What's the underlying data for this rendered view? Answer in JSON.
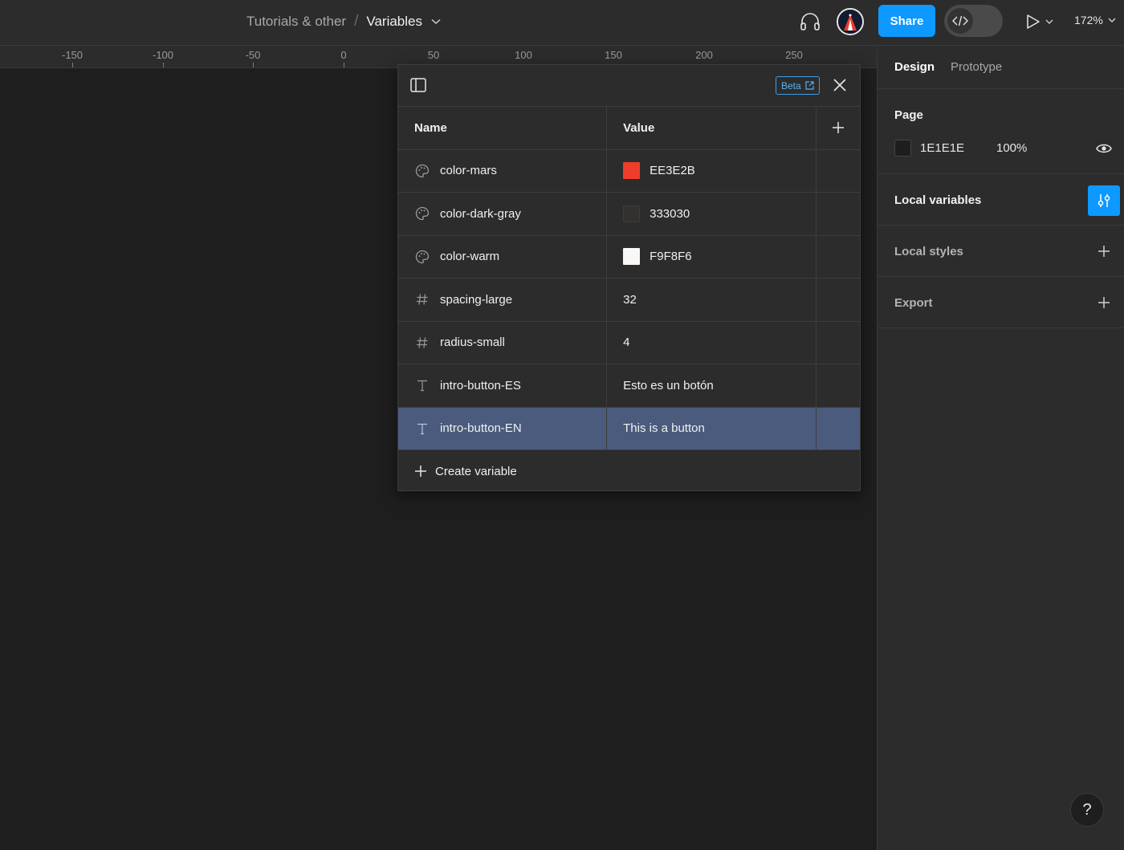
{
  "header": {
    "breadcrumb_parent": "Tutorials & other",
    "breadcrumb_sep": "/",
    "file_name": "Variables",
    "share_label": "Share",
    "zoom_level": "172%"
  },
  "ruler": {
    "ticks": [
      "-150",
      "-100",
      "-50",
      "0",
      "50",
      "100",
      "150",
      "200",
      "250"
    ]
  },
  "right_panel": {
    "tabs": [
      "Design",
      "Prototype"
    ],
    "page": {
      "title": "Page",
      "background_hex": "1E1E1E",
      "opacity": "100%"
    },
    "local_variables": "Local variables",
    "local_styles": "Local styles",
    "export": "Export"
  },
  "modal": {
    "beta_label": "Beta",
    "columns": {
      "name": "Name",
      "value": "Value"
    },
    "rows": [
      {
        "type": "color",
        "icon": "palette-icon",
        "name": "color-mars",
        "value": "EE3E2B",
        "swatch": "#EE3E2B"
      },
      {
        "type": "color",
        "icon": "palette-icon",
        "name": "color-dark-gray",
        "value": "333030",
        "swatch": "#333030"
      },
      {
        "type": "color",
        "icon": "palette-icon",
        "name": "color-warm",
        "value": "F9F8F6",
        "swatch": "#F9F8F6"
      },
      {
        "type": "number",
        "icon": "hash-icon",
        "name": "spacing-large",
        "value": "32"
      },
      {
        "type": "number",
        "icon": "hash-icon",
        "name": "radius-small",
        "value": "4"
      },
      {
        "type": "string",
        "icon": "text-icon",
        "name": "intro-button-ES",
        "value": "Esto es un botón"
      },
      {
        "type": "string",
        "icon": "text-icon",
        "name": "intro-button-EN",
        "value": "This is a button",
        "selected": true
      }
    ],
    "create_label": "Create variable"
  },
  "help_label": "?",
  "colors": {
    "accent": "#0d99ff",
    "selected_row": "#4a5b7e"
  }
}
